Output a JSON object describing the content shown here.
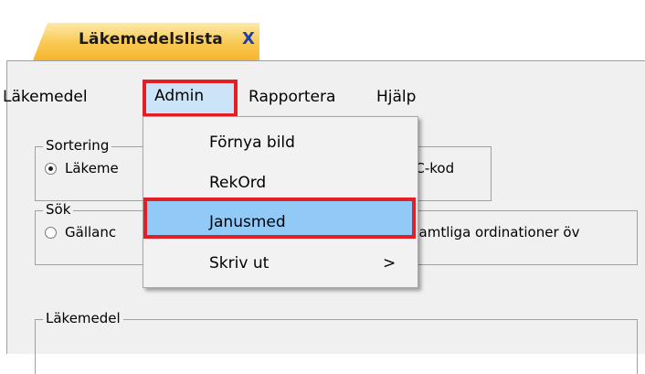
{
  "tab": {
    "title": "Läkemedelslista",
    "close": "X"
  },
  "menubar": {
    "items": [
      "Läkemedel",
      "Admin",
      "Rapportera",
      "Hjälp"
    ]
  },
  "sortering": {
    "title": "Sortering",
    "option1": "Läkeme",
    "option2": "ATC-kod"
  },
  "sok": {
    "title": "Sök",
    "option1": "Gällanc",
    "option2": "Samtliga ordinationer öv"
  },
  "lakemedel_group": {
    "title": "Läkemedel"
  },
  "admin_menu": {
    "items": [
      "Förnya bild",
      "RekOrd",
      "Janusmed",
      "Skriv ut"
    ],
    "submenu_arrow": ">",
    "highlighted": "Janusmed"
  },
  "colors": {
    "tab": "#f9c851",
    "annotation_red": "#e31e24",
    "hover_blue": "#91c9f7"
  }
}
